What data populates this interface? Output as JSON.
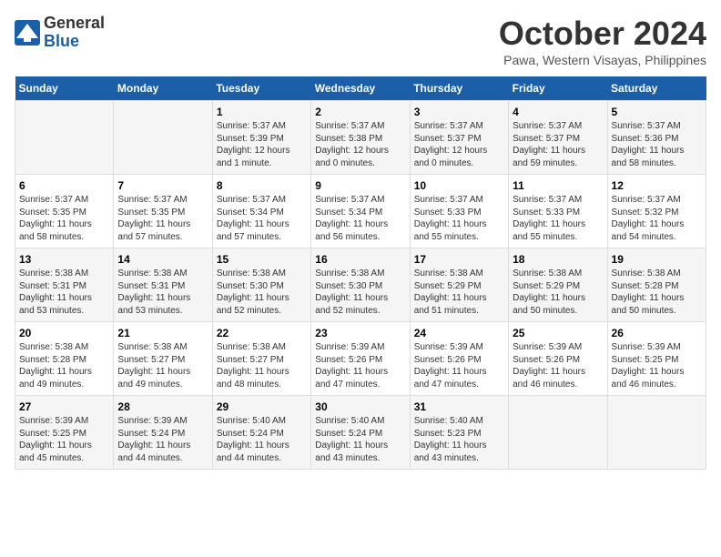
{
  "header": {
    "logo_line1": "General",
    "logo_line2": "Blue",
    "month": "October 2024",
    "location": "Pawa, Western Visayas, Philippines"
  },
  "columns": [
    "Sunday",
    "Monday",
    "Tuesday",
    "Wednesday",
    "Thursday",
    "Friday",
    "Saturday"
  ],
  "weeks": [
    [
      {
        "day": "",
        "info": ""
      },
      {
        "day": "",
        "info": ""
      },
      {
        "day": "1",
        "info": "Sunrise: 5:37 AM\nSunset: 5:39 PM\nDaylight: 12 hours\nand 1 minute."
      },
      {
        "day": "2",
        "info": "Sunrise: 5:37 AM\nSunset: 5:38 PM\nDaylight: 12 hours\nand 0 minutes."
      },
      {
        "day": "3",
        "info": "Sunrise: 5:37 AM\nSunset: 5:37 PM\nDaylight: 12 hours\nand 0 minutes."
      },
      {
        "day": "4",
        "info": "Sunrise: 5:37 AM\nSunset: 5:37 PM\nDaylight: 11 hours\nand 59 minutes."
      },
      {
        "day": "5",
        "info": "Sunrise: 5:37 AM\nSunset: 5:36 PM\nDaylight: 11 hours\nand 58 minutes."
      }
    ],
    [
      {
        "day": "6",
        "info": "Sunrise: 5:37 AM\nSunset: 5:35 PM\nDaylight: 11 hours\nand 58 minutes."
      },
      {
        "day": "7",
        "info": "Sunrise: 5:37 AM\nSunset: 5:35 PM\nDaylight: 11 hours\nand 57 minutes."
      },
      {
        "day": "8",
        "info": "Sunrise: 5:37 AM\nSunset: 5:34 PM\nDaylight: 11 hours\nand 57 minutes."
      },
      {
        "day": "9",
        "info": "Sunrise: 5:37 AM\nSunset: 5:34 PM\nDaylight: 11 hours\nand 56 minutes."
      },
      {
        "day": "10",
        "info": "Sunrise: 5:37 AM\nSunset: 5:33 PM\nDaylight: 11 hours\nand 55 minutes."
      },
      {
        "day": "11",
        "info": "Sunrise: 5:37 AM\nSunset: 5:33 PM\nDaylight: 11 hours\nand 55 minutes."
      },
      {
        "day": "12",
        "info": "Sunrise: 5:37 AM\nSunset: 5:32 PM\nDaylight: 11 hours\nand 54 minutes."
      }
    ],
    [
      {
        "day": "13",
        "info": "Sunrise: 5:38 AM\nSunset: 5:31 PM\nDaylight: 11 hours\nand 53 minutes."
      },
      {
        "day": "14",
        "info": "Sunrise: 5:38 AM\nSunset: 5:31 PM\nDaylight: 11 hours\nand 53 minutes."
      },
      {
        "day": "15",
        "info": "Sunrise: 5:38 AM\nSunset: 5:30 PM\nDaylight: 11 hours\nand 52 minutes."
      },
      {
        "day": "16",
        "info": "Sunrise: 5:38 AM\nSunset: 5:30 PM\nDaylight: 11 hours\nand 52 minutes."
      },
      {
        "day": "17",
        "info": "Sunrise: 5:38 AM\nSunset: 5:29 PM\nDaylight: 11 hours\nand 51 minutes."
      },
      {
        "day": "18",
        "info": "Sunrise: 5:38 AM\nSunset: 5:29 PM\nDaylight: 11 hours\nand 50 minutes."
      },
      {
        "day": "19",
        "info": "Sunrise: 5:38 AM\nSunset: 5:28 PM\nDaylight: 11 hours\nand 50 minutes."
      }
    ],
    [
      {
        "day": "20",
        "info": "Sunrise: 5:38 AM\nSunset: 5:28 PM\nDaylight: 11 hours\nand 49 minutes."
      },
      {
        "day": "21",
        "info": "Sunrise: 5:38 AM\nSunset: 5:27 PM\nDaylight: 11 hours\nand 49 minutes."
      },
      {
        "day": "22",
        "info": "Sunrise: 5:38 AM\nSunset: 5:27 PM\nDaylight: 11 hours\nand 48 minutes."
      },
      {
        "day": "23",
        "info": "Sunrise: 5:39 AM\nSunset: 5:26 PM\nDaylight: 11 hours\nand 47 minutes."
      },
      {
        "day": "24",
        "info": "Sunrise: 5:39 AM\nSunset: 5:26 PM\nDaylight: 11 hours\nand 47 minutes."
      },
      {
        "day": "25",
        "info": "Sunrise: 5:39 AM\nSunset: 5:26 PM\nDaylight: 11 hours\nand 46 minutes."
      },
      {
        "day": "26",
        "info": "Sunrise: 5:39 AM\nSunset: 5:25 PM\nDaylight: 11 hours\nand 46 minutes."
      }
    ],
    [
      {
        "day": "27",
        "info": "Sunrise: 5:39 AM\nSunset: 5:25 PM\nDaylight: 11 hours\nand 45 minutes."
      },
      {
        "day": "28",
        "info": "Sunrise: 5:39 AM\nSunset: 5:24 PM\nDaylight: 11 hours\nand 44 minutes."
      },
      {
        "day": "29",
        "info": "Sunrise: 5:40 AM\nSunset: 5:24 PM\nDaylight: 11 hours\nand 44 minutes."
      },
      {
        "day": "30",
        "info": "Sunrise: 5:40 AM\nSunset: 5:24 PM\nDaylight: 11 hours\nand 43 minutes."
      },
      {
        "day": "31",
        "info": "Sunrise: 5:40 AM\nSunset: 5:23 PM\nDaylight: 11 hours\nand 43 minutes."
      },
      {
        "day": "",
        "info": ""
      },
      {
        "day": "",
        "info": ""
      }
    ]
  ]
}
